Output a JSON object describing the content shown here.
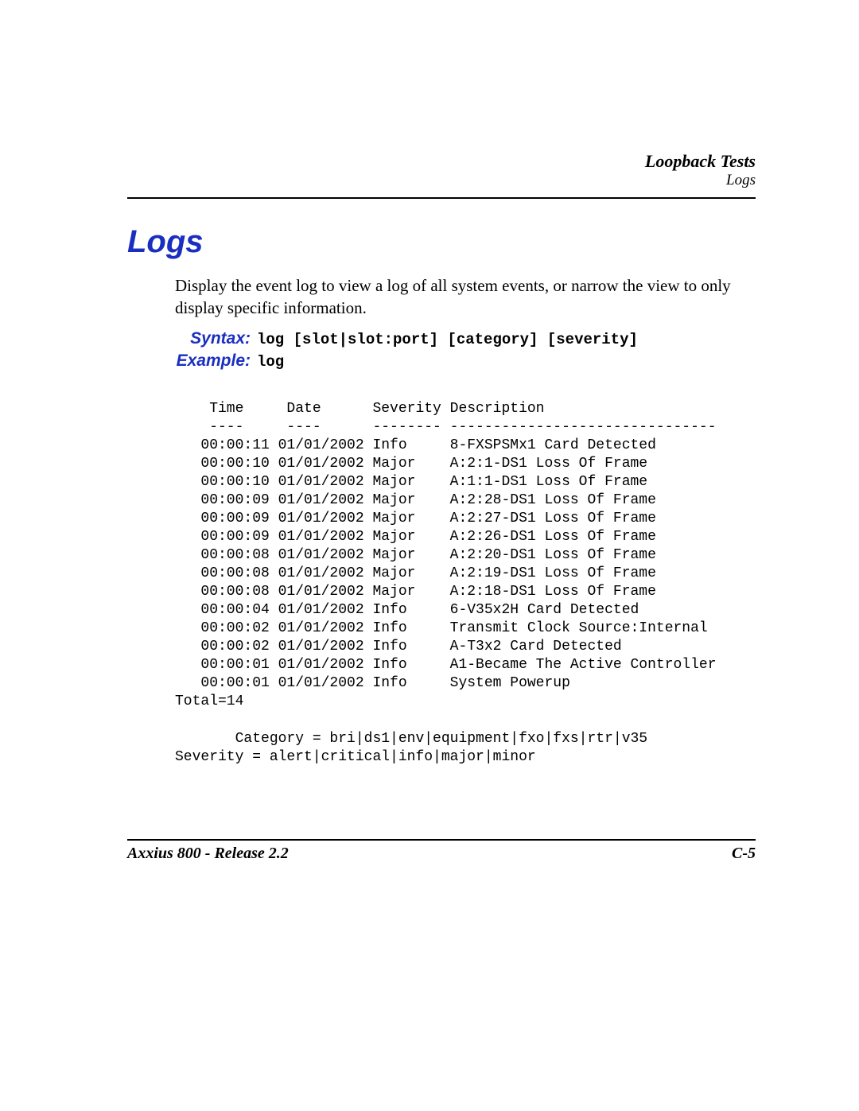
{
  "running_head": {
    "chapter": "Loopback Tests",
    "section": "Logs"
  },
  "title": "Logs",
  "intro": "Display the event log to view a log of all system events, or narrow the view to only display specific information.",
  "syntax": {
    "label": "Syntax:",
    "text": "log [slot|slot:port] [category] [severity]"
  },
  "example": {
    "label": "Example:",
    "text": "log"
  },
  "log_header": {
    "time": "Time",
    "date": "Date",
    "severity": "Severity",
    "description": "Description"
  },
  "log_divider": {
    "time": "----",
    "date": "----",
    "severity": "--------",
    "description": "-------------------------------"
  },
  "log_rows": [
    {
      "time": "00:00:11",
      "date": "01/01/2002",
      "severity": "Info",
      "description": "8-FXSPSMx1 Card Detected"
    },
    {
      "time": "00:00:10",
      "date": "01/01/2002",
      "severity": "Major",
      "description": "A:2:1-DS1 Loss Of Frame"
    },
    {
      "time": "00:00:10",
      "date": "01/01/2002",
      "severity": "Major",
      "description": "A:1:1-DS1 Loss Of Frame"
    },
    {
      "time": "00:00:09",
      "date": "01/01/2002",
      "severity": "Major",
      "description": "A:2:28-DS1 Loss Of Frame"
    },
    {
      "time": "00:00:09",
      "date": "01/01/2002",
      "severity": "Major",
      "description": "A:2:27-DS1 Loss Of Frame"
    },
    {
      "time": "00:00:09",
      "date": "01/01/2002",
      "severity": "Major",
      "description": "A:2:26-DS1 Loss Of Frame"
    },
    {
      "time": "00:00:08",
      "date": "01/01/2002",
      "severity": "Major",
      "description": "A:2:20-DS1 Loss Of Frame"
    },
    {
      "time": "00:00:08",
      "date": "01/01/2002",
      "severity": "Major",
      "description": "A:2:19-DS1 Loss Of Frame"
    },
    {
      "time": "00:00:08",
      "date": "01/01/2002",
      "severity": "Major",
      "description": "A:2:18-DS1 Loss Of Frame"
    },
    {
      "time": "00:00:04",
      "date": "01/01/2002",
      "severity": "Info",
      "description": "6-V35x2H Card Detected"
    },
    {
      "time": "00:00:02",
      "date": "01/01/2002",
      "severity": "Info",
      "description": "Transmit Clock Source:Internal"
    },
    {
      "time": "00:00:02",
      "date": "01/01/2002",
      "severity": "Info",
      "description": "A-T3x2 Card Detected"
    },
    {
      "time": "00:00:01",
      "date": "01/01/2002",
      "severity": "Info",
      "description": "A1-Became The Active Controller"
    },
    {
      "time": "00:00:01",
      "date": "01/01/2002",
      "severity": "Info",
      "description": "System Powerup"
    }
  ],
  "total_line": "Total=14",
  "category_line": "       Category = bri|ds1|env|equipment|fxo|fxs|rtr|v35",
  "severity_line": "Severity = alert|critical|info|major|minor",
  "footer": {
    "left": "Axxius 800 - Release 2.2",
    "right": "C-5"
  }
}
